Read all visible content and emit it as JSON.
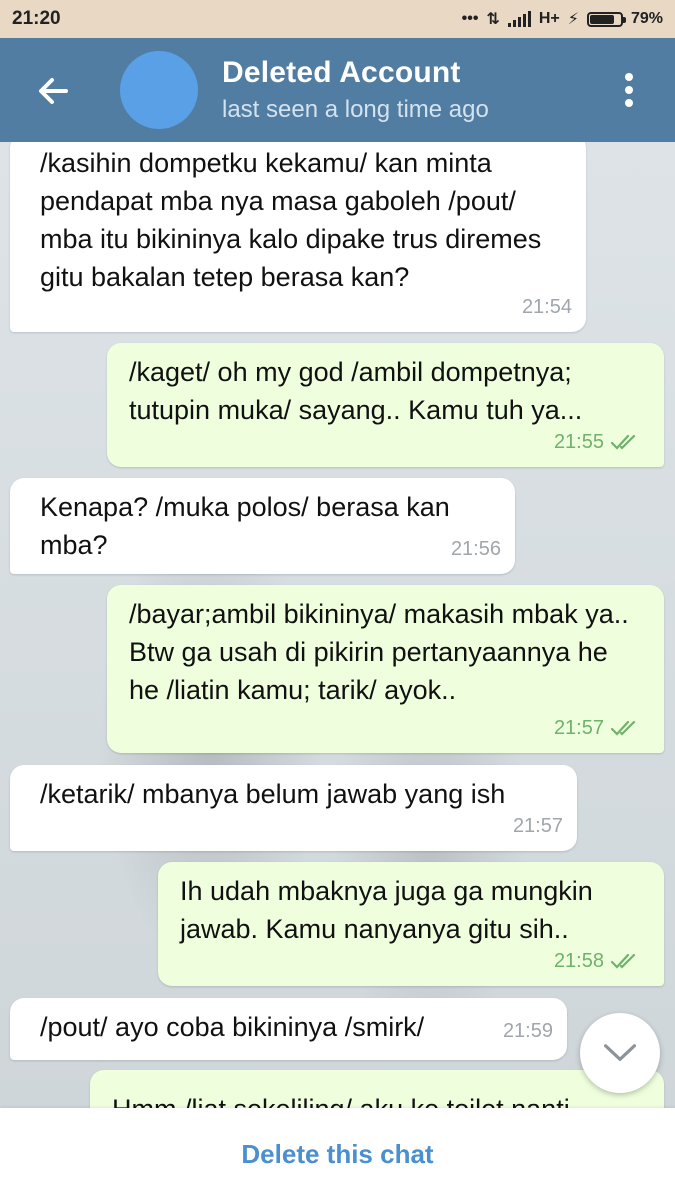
{
  "status": {
    "time": "21:20",
    "network": "H+",
    "battery_percent": "79%",
    "battery_level": 0.79
  },
  "header": {
    "title": "Deleted Account",
    "subtitle": "last seen a long time ago"
  },
  "messages": [
    {
      "dir": "in",
      "text": "/kasihin dompetku kekamu/ kan minta pendapat mba nya masa gaboleh /pout/ mba itu bikininya kalo dipake trus diremes gitu bakalan tetep berasa kan?",
      "time": "21:54"
    },
    {
      "dir": "out",
      "text": "/kaget/ oh my god /ambil dompetnya; tutupin muka/ sayang.. Kamu tuh ya...",
      "time": "21:55"
    },
    {
      "dir": "in",
      "text": "Kenapa? /muka polos/ berasa kan mba?",
      "time": "21:56"
    },
    {
      "dir": "out",
      "text": "/bayar;ambil bikininya/ makasih mbak ya.. Btw ga usah di pikirin pertanyaannya he he /liatin kamu; tarik/ ayok..",
      "time": "21:57"
    },
    {
      "dir": "in",
      "text": "/ketarik/ mbanya belum jawab yang ish",
      "time": "21:57"
    },
    {
      "dir": "out",
      "text": "Ih udah mbaknya juga ga mungkin jawab. Kamu nanyanya gitu sih..",
      "time": "21:58"
    },
    {
      "dir": "in",
      "text": "/pout/ ayo coba bikininya /smirk/",
      "time": "21:59"
    },
    {
      "dir": "out",
      "text": "Hmm /liat sekeliling/ aku ke toilet nanti",
      "time": ""
    }
  ],
  "footer": {
    "delete_label": "Delete this chat"
  },
  "colors": {
    "header": "#517da2",
    "incoming_bubble": "#ffffff",
    "outgoing_bubble": "#efffde",
    "accent": "#4a8fcf"
  }
}
